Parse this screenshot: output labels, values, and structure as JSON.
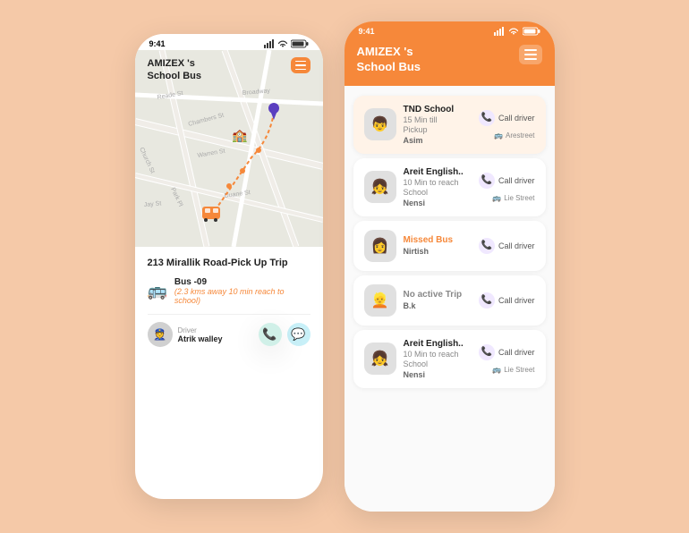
{
  "background": "#f5c9a8",
  "leftPhone": {
    "statusBar": {
      "time": "9:41",
      "icons": "signal wifi battery"
    },
    "header": {
      "title": "AMIZEX 's\nSchool Bus",
      "menuLabel": "menu"
    },
    "trip": {
      "title": "213 Mirallik Road-Pick Up Trip",
      "busNumber": "Bus -09",
      "busDistance": "(2.3 kms away 10 min reach to school)",
      "driverLabel": "Driver",
      "driverName": "Atrik walley"
    }
  },
  "rightPhone": {
    "statusBar": {
      "time": "9:41",
      "icons": "signal wifi battery"
    },
    "header": {
      "title": "AMIZEX 's\nSchool Bus",
      "menuLabel": "menu"
    },
    "listItems": [
      {
        "id": 1,
        "avatar": "👦",
        "name": "TND School",
        "sub1": "15 Min till",
        "sub2": "Pickup",
        "location": "Arestreet",
        "callLabel": "Call driver",
        "bottomName": "Asim",
        "highlighted": true
      },
      {
        "id": 2,
        "avatar": "👧",
        "name": "Areit English..",
        "sub1": "10 Min to reach",
        "sub2": "School",
        "location": "Lie Street",
        "callLabel": "Call driver",
        "bottomName": "Nensi",
        "highlighted": false
      },
      {
        "id": 3,
        "avatar": "👩",
        "name": "Missed Bus",
        "sub1": "",
        "sub2": "",
        "location": "",
        "callLabel": "Call driver",
        "bottomName": "Nirtish",
        "highlighted": false,
        "missed": true
      },
      {
        "id": 4,
        "avatar": "👱",
        "name": "No active Trip",
        "sub1": "",
        "sub2": "",
        "location": "",
        "callLabel": "Call driver",
        "bottomName": "B.k",
        "highlighted": false,
        "noActive": true
      },
      {
        "id": 5,
        "avatar": "👧",
        "name": "Areit English..",
        "sub1": "10 Min to reach",
        "sub2": "School",
        "location": "Lie Street",
        "callLabel": "Call driver",
        "bottomName": "Nensi",
        "highlighted": false
      }
    ]
  }
}
